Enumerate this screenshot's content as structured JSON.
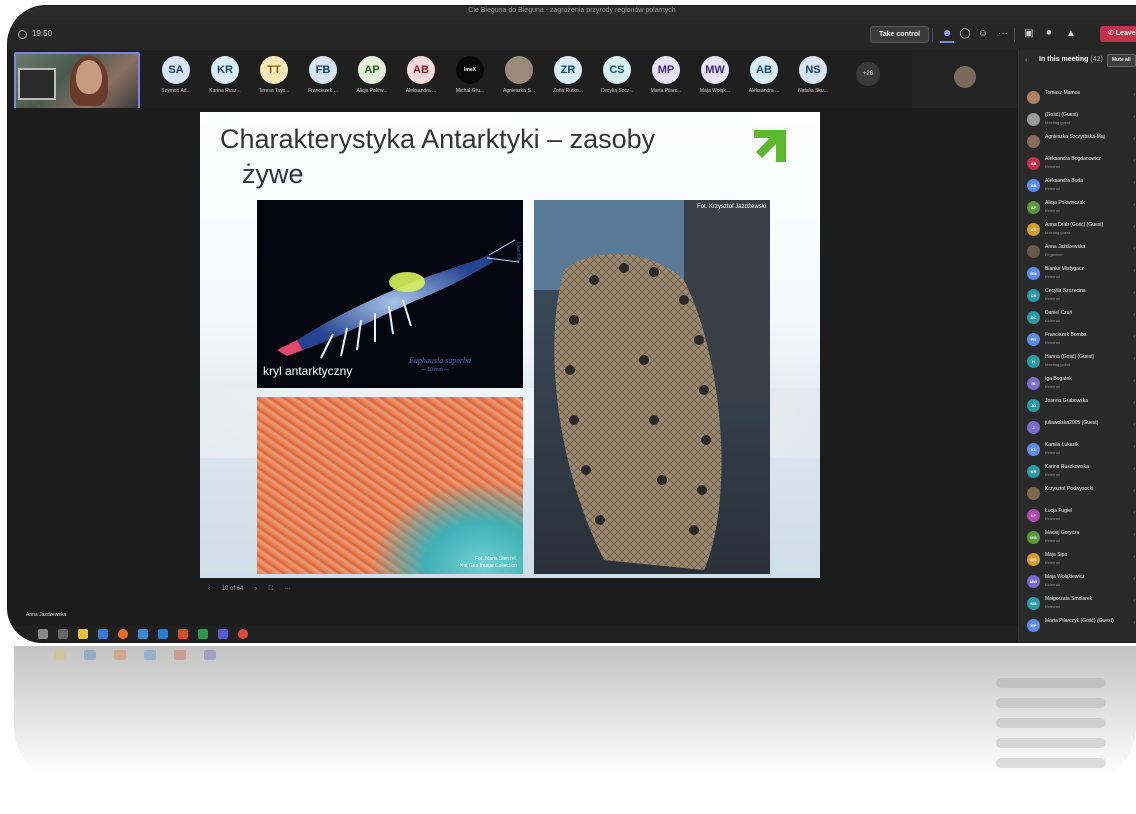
{
  "window": {
    "title": "Cie Bieguna do Bieguna - zagrożenia przyrody regionów polarnych"
  },
  "toolbar": {
    "timer": "19:50",
    "take_control_label": "Take control",
    "people_icon": "people-icon",
    "chat_icon": "chat-icon",
    "reactions_icon": "reactions-icon",
    "more_icon": "more-icon",
    "camera_icon": "camera-icon",
    "mic_icon": "mic-icon",
    "share_icon": "share-icon",
    "leave_label": "Leave",
    "accent": "#7b83eb",
    "leave_color": "#c4314b"
  },
  "participants": [
    {
      "initials": "SA",
      "name": "Szymon Ad...",
      "bg": "#d6e4f7",
      "fg": "#1b3a6b"
    },
    {
      "initials": "KR",
      "name": "Karina Rusz...",
      "bg": "#d9ecf6",
      "fg": "#114b6b"
    },
    {
      "initials": "TT",
      "name": "Teresa Tays...",
      "bg": "#fbe7b8",
      "fg": "#8a5a00"
    },
    {
      "initials": "FB",
      "name": "Franciszek ...",
      "bg": "#d6e4f7",
      "fg": "#1b3a6b"
    },
    {
      "initials": "AP",
      "name": "Alicja Pokrw...",
      "bg": "#e3f0d9",
      "fg": "#2f5a1a"
    },
    {
      "initials": "AB",
      "name": "Aleksandra ...",
      "bg": "#f7d9dc",
      "fg": "#8a1c2a"
    },
    {
      "initials": "ImeX",
      "name": "Michał Gru...",
      "bg": "#0a0a0a",
      "fg": "#ffffff"
    },
    {
      "initials": "",
      "name": "Agnieszka S...",
      "bg": "#9b8a7a",
      "fg": "#ffffff"
    },
    {
      "initials": "ZR",
      "name": "Zofia Rutko...",
      "bg": "#d9ecf6",
      "fg": "#114b6b"
    },
    {
      "initials": "CS",
      "name": "Cecylia Szcz...",
      "bg": "#d6eef0",
      "fg": "#145a63"
    },
    {
      "initials": "MP",
      "name": "Marta Pilarc...",
      "bg": "#e6e2f7",
      "fg": "#3b2c7a"
    },
    {
      "initials": "MW",
      "name": "Maja Wołąk...",
      "bg": "#e6e2f7",
      "fg": "#3b2c7a"
    },
    {
      "initials": "AB",
      "name": "Aleksandra ...",
      "bg": "#d9ecf6",
      "fg": "#114b6b"
    },
    {
      "initials": "NS",
      "name": "Natalia Sku...",
      "bg": "#d6e4f7",
      "fg": "#1b3a6b"
    }
  ],
  "overflow_count": "+26",
  "slide": {
    "title_line1": "Charakterystyka Antarktyki – zasoby",
    "title_line2": "żywe",
    "krill_label": "kryl antarktyczny",
    "krill_scientific": "Euphausia superba",
    "krill_scale": "— 10 mm —",
    "krill_credit": "Uwe Kils",
    "swarm_credit_line1": "Fot. Maria Stenzel,",
    "swarm_credit_line2": "Nat Geo Image Collection",
    "net_credit": "Fot. Krzysztof Jażdżewski",
    "logo_color": "#5cb82e"
  },
  "slide_controls": {
    "prev_icon": "‹",
    "counter": "10 of 64",
    "next_icon": "›",
    "fullscreen_icon": "⛶",
    "more": "···"
  },
  "presenter_name": "Anna Jażdżewska",
  "roster": {
    "title": "In this meeting",
    "count": "(42)",
    "mute_all_label": "Mute all",
    "back_icon": "‹",
    "members": [
      {
        "name": "Tomasz Mamos",
        "sub": "",
        "initials": "",
        "bg": "#b08060"
      },
      {
        "name": "(Gość) (Guest)",
        "sub": "Meeting guest",
        "initials": "",
        "bg": "#9a9a9a"
      },
      {
        "name": "Agnieszka Szczyrbska-Maj",
        "sub": "",
        "initials": "",
        "bg": "#8a6a5a"
      },
      {
        "name": "Aleksandra Bogdanowicz",
        "sub": "External",
        "initials": "AB",
        "bg": "#c4314b"
      },
      {
        "name": "Aleksandra Buda",
        "sub": "External",
        "initials": "AB",
        "bg": "#5b8def"
      },
      {
        "name": "Alicja Pokwinczak",
        "sub": "External",
        "initials": "AP",
        "bg": "#5a9a3a"
      },
      {
        "name": "Anna Drab (Gość) (Guest)",
        "sub": "Meeting guest",
        "initials": "AD",
        "bg": "#d89a2a"
      },
      {
        "name": "Anna Jażdżewska",
        "sub": "Organiser",
        "initials": "",
        "bg": "#6a5a4a"
      },
      {
        "name": "Bianka Mistygacz",
        "sub": "External",
        "initials": "BM",
        "bg": "#5b8def"
      },
      {
        "name": "Cecylia Szczecina",
        "sub": "External",
        "initials": "CS",
        "bg": "#2a9aa8"
      },
      {
        "name": "Daniel Czuń",
        "sub": "External",
        "initials": "DC",
        "bg": "#2a9aa8"
      },
      {
        "name": "Franciszek Bomba",
        "sub": "External",
        "initials": "FB",
        "bg": "#5b8def"
      },
      {
        "name": "Hanna (Gość) (Guest)",
        "sub": "Meeting guest",
        "initials": "H",
        "bg": "#2a9aa8"
      },
      {
        "name": "Iga Bogatek",
        "sub": "External",
        "initials": "IB",
        "bg": "#7b6ad0"
      },
      {
        "name": "Joanna Grabowska",
        "sub": "",
        "initials": "JG",
        "bg": "#2a9aa8"
      },
      {
        "name": "juliawolska2005 (Guest)",
        "sub": "",
        "initials": "J",
        "bg": "#7b6ad0"
      },
      {
        "name": "Kamila Łukasik",
        "sub": "External",
        "initials": "KL",
        "bg": "#5b8def"
      },
      {
        "name": "Karina Ruszkowska",
        "sub": "External",
        "initials": "KR",
        "bg": "#2a9aa8"
      },
      {
        "name": "Krzysztof Podwysocki",
        "sub": "",
        "initials": "",
        "bg": "#7a6a4a"
      },
      {
        "name": "Łucja Fugiel",
        "sub": "External",
        "initials": "ŁF",
        "bg": "#b04ab0"
      },
      {
        "name": "Maciej Gorycza",
        "sub": "External",
        "initials": "MG",
        "bg": "#5a9a3a"
      },
      {
        "name": "Maja Sipa",
        "sub": "External",
        "initials": "MS",
        "bg": "#d8a02a"
      },
      {
        "name": "Maja Wołąkiewicz",
        "sub": "External",
        "initials": "MW",
        "bg": "#7b6ad0"
      },
      {
        "name": "Małgorzata Smolarek",
        "sub": "External",
        "initials": "MS",
        "bg": "#2a9aa8"
      },
      {
        "name": "Marta Pilarczyk (Gość) (Guest)",
        "sub": "",
        "initials": "MP",
        "bg": "#5b8def"
      }
    ]
  }
}
